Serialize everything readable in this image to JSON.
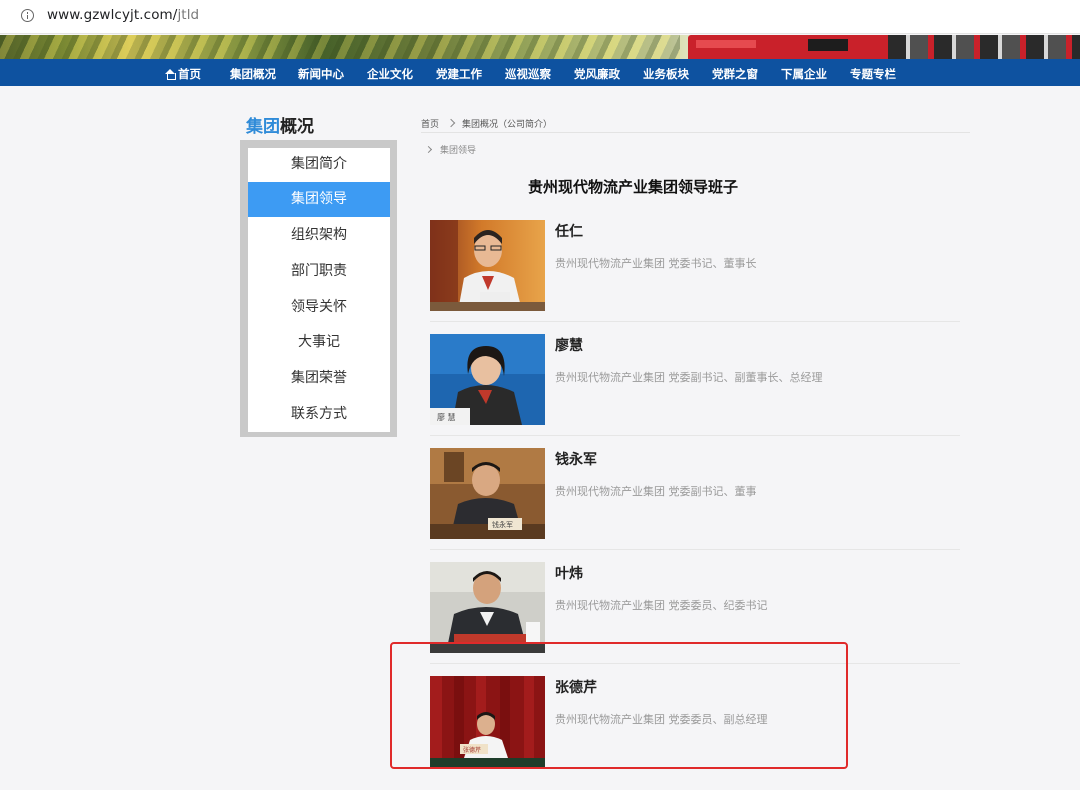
{
  "browser": {
    "url_host": "www.gzwlcyjt.com/",
    "url_path": "jtld"
  },
  "nav": {
    "items": [
      "首页",
      "集团概况",
      "新闻中心",
      "企业文化",
      "党建工作",
      "巡视巡察",
      "党风廉政",
      "业务板块",
      "党群之窗",
      "下属企业",
      "专题专栏"
    ]
  },
  "sidebar": {
    "title_highlight": "集团",
    "title_rest": "概况",
    "items": [
      "集团简介",
      "集团领导",
      "组织架构",
      "部门职责",
      "领导关怀",
      "大事记",
      "集团荣誉",
      "联系方式"
    ],
    "active_index": 1
  },
  "breadcrumb": {
    "home": "首页",
    "section": "集团概况（公司简介）",
    "current": "集团领导"
  },
  "main": {
    "title": "贵州现代物流产业集团领导班子",
    "leaders": [
      {
        "name": "任仁",
        "title": "贵州现代物流产业集团  党委书记、董事长"
      },
      {
        "name": "廖慧",
        "title": "贵州现代物流产业集团  党委副书记、副董事长、总经理"
      },
      {
        "name": "钱永军",
        "title": "贵州现代物流产业集团  党委副书记、董事"
      },
      {
        "name": "叶炜",
        "title": "贵州现代物流产业集团  党委委员、纪委书记"
      },
      {
        "name": "张德芹",
        "title": "贵州现代物流产业集团  党委委员、副总经理"
      }
    ],
    "nameplate_texts": [
      "廖  慧",
      "钱永军",
      "张德芹"
    ]
  },
  "colors": {
    "nav_bg": "#0e52a0",
    "sidebar_active": "#3d9bf3",
    "title_highlight": "#2f8bd8",
    "annotation_box": "#e02a2a"
  },
  "annotation": {
    "highlighted_leader_index": 4
  }
}
